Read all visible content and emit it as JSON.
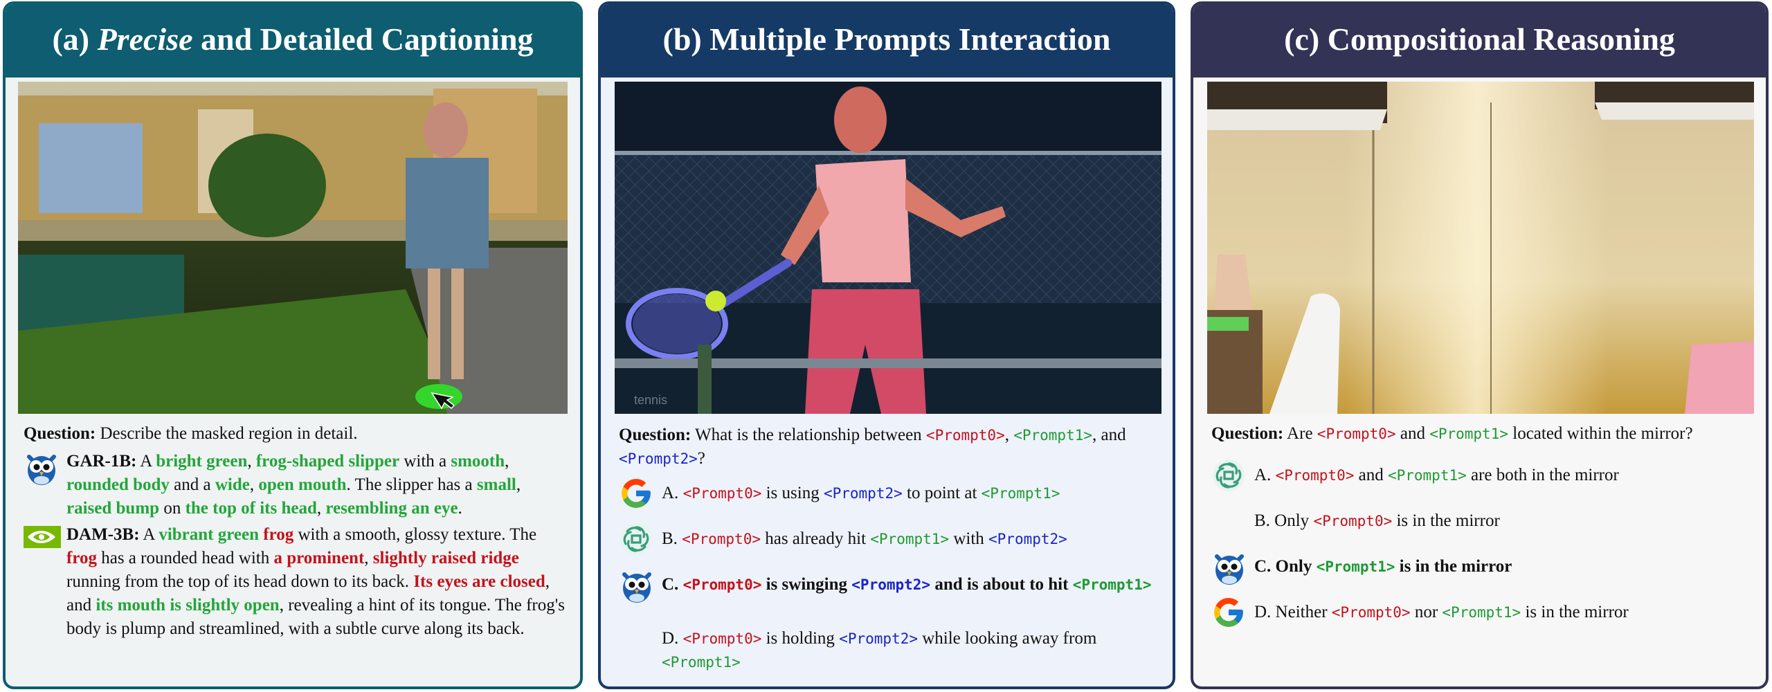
{
  "panels": {
    "a": {
      "title_prefix": "(a) ",
      "title_italic": "Precise",
      "title_suffix": " and Detailed Captioning",
      "question_label": "Question:",
      "question_text": " Describe the masked region in detail.",
      "gar": {
        "label": "GAR-1B:",
        "segments": [
          {
            "t": " A ",
            "c": ""
          },
          {
            "t": "bright green",
            "c": "green"
          },
          {
            "t": ", ",
            "c": ""
          },
          {
            "t": "frog-shaped slipper",
            "c": "green"
          },
          {
            "t": " with a ",
            "c": ""
          },
          {
            "t": "smooth",
            "c": "green"
          },
          {
            "t": ", ",
            "c": ""
          },
          {
            "t": "rounded body",
            "c": "green"
          },
          {
            "t": " and a ",
            "c": ""
          },
          {
            "t": "wide",
            "c": "green"
          },
          {
            "t": ", ",
            "c": ""
          },
          {
            "t": "open mouth",
            "c": "green"
          },
          {
            "t": ". The slipper has a ",
            "c": ""
          },
          {
            "t": "small",
            "c": "green"
          },
          {
            "t": ", ",
            "c": ""
          },
          {
            "t": "raised bump",
            "c": "green"
          },
          {
            "t": " on ",
            "c": ""
          },
          {
            "t": "the top of its head",
            "c": "green"
          },
          {
            "t": ", ",
            "c": ""
          },
          {
            "t": "resembling an eye",
            "c": "green"
          },
          {
            "t": ".",
            "c": ""
          }
        ]
      },
      "dam": {
        "label": "DAM-3B:",
        "segments": [
          {
            "t": " A ",
            "c": ""
          },
          {
            "t": "vibrant green",
            "c": "green"
          },
          {
            "t": " ",
            "c": ""
          },
          {
            "t": "frog",
            "c": "red"
          },
          {
            "t": " with a smooth, glossy texture. The ",
            "c": ""
          },
          {
            "t": "frog",
            "c": "red"
          },
          {
            "t": " has a rounded head with ",
            "c": ""
          },
          {
            "t": "a prominent",
            "c": "red"
          },
          {
            "t": ", ",
            "c": ""
          },
          {
            "t": "slightly raised ridge",
            "c": "red"
          },
          {
            "t": " running from the top of its head down to its back. ",
            "c": ""
          },
          {
            "t": "Its eyes are closed",
            "c": "red"
          },
          {
            "t": ", and ",
            "c": ""
          },
          {
            "t": "its mouth is slightly open",
            "c": "green"
          },
          {
            "t": ", revealing a hint of its tongue. The frog's body is plump and streamlined, with a subtle curve along its back.",
            "c": ""
          }
        ]
      }
    },
    "b": {
      "title": "(b) Multiple Prompts Interaction",
      "watermark": "tennis",
      "question_label": "Question:",
      "question_segments": [
        {
          "t": " What is the relationship between ",
          "c": ""
        },
        {
          "t": "<Prompt0>",
          "c": "p0"
        },
        {
          "t": ", ",
          "c": ""
        },
        {
          "t": "<Prompt1>",
          "c": "p1"
        },
        {
          "t": ", and ",
          "c": ""
        },
        {
          "t": "<Prompt2>",
          "c": "p2"
        },
        {
          "t": "?",
          "c": ""
        }
      ],
      "options": [
        {
          "logo": "google",
          "bold": false,
          "segments": [
            {
              "t": "A. ",
              "c": ""
            },
            {
              "t": "<Prompt0>",
              "c": "p0"
            },
            {
              "t": " is using ",
              "c": ""
            },
            {
              "t": "<Prompt2>",
              "c": "p2"
            },
            {
              "t": " to point at ",
              "c": ""
            },
            {
              "t": "<Prompt1>",
              "c": "p1"
            }
          ]
        },
        {
          "logo": "openai",
          "bold": false,
          "segments": [
            {
              "t": "B. ",
              "c": ""
            },
            {
              "t": "<Prompt0>",
              "c": "p0"
            },
            {
              "t": " has already hit ",
              "c": ""
            },
            {
              "t": "<Prompt1>",
              "c": "p1"
            },
            {
              "t": " with ",
              "c": ""
            },
            {
              "t": "<Prompt2>",
              "c": "p2"
            }
          ]
        },
        {
          "logo": "owl",
          "bold": true,
          "segments": [
            {
              "t": "C. ",
              "c": ""
            },
            {
              "t": "<Prompt0>",
              "c": "p0"
            },
            {
              "t": " is swinging ",
              "c": ""
            },
            {
              "t": "<Prompt2>",
              "c": "p2"
            },
            {
              "t": " and is about to hit ",
              "c": ""
            },
            {
              "t": "<Prompt1>",
              "c": "p1"
            }
          ]
        },
        {
          "logo": "",
          "bold": false,
          "segments": [
            {
              "t": "D. ",
              "c": ""
            },
            {
              "t": "<Prompt0>",
              "c": "p0"
            },
            {
              "t": " is holding ",
              "c": ""
            },
            {
              "t": "<Prompt2>",
              "c": "p2"
            },
            {
              "t": " while looking away from ",
              "c": ""
            },
            {
              "t": "<Prompt1>",
              "c": "p1"
            }
          ]
        }
      ]
    },
    "c": {
      "title": "(c) Compositional Reasoning",
      "question_label": "Question:",
      "question_segments": [
        {
          "t": " Are ",
          "c": ""
        },
        {
          "t": "<Prompt0>",
          "c": "p0"
        },
        {
          "t": " and ",
          "c": ""
        },
        {
          "t": "<Prompt1>",
          "c": "p1"
        },
        {
          "t": " located within the mirror?",
          "c": ""
        }
      ],
      "options": [
        {
          "logo": "openai",
          "bold": false,
          "segments": [
            {
              "t": "A. ",
              "c": ""
            },
            {
              "t": "<Prompt0>",
              "c": "p0"
            },
            {
              "t": " and ",
              "c": ""
            },
            {
              "t": "<Prompt1>",
              "c": "p1"
            },
            {
              "t": " are both in the mirror",
              "c": ""
            }
          ]
        },
        {
          "logo": "",
          "bold": false,
          "segments": [
            {
              "t": "B. Only ",
              "c": ""
            },
            {
              "t": "<Prompt0>",
              "c": "p0"
            },
            {
              "t": " is in the mirror",
              "c": ""
            }
          ]
        },
        {
          "logo": "owl",
          "bold": true,
          "segments": [
            {
              "t": "C. Only ",
              "c": ""
            },
            {
              "t": "<Prompt1>",
              "c": "p1"
            },
            {
              "t": " is in the mirror",
              "c": ""
            }
          ]
        },
        {
          "logo": "google",
          "bold": false,
          "segments": [
            {
              "t": "D. Neither ",
              "c": ""
            },
            {
              "t": "<Prompt0>",
              "c": "p0"
            },
            {
              "t": " nor ",
              "c": ""
            },
            {
              "t": "<Prompt1>",
              "c": "p1"
            },
            {
              "t": " is in the mirror",
              "c": ""
            }
          ]
        }
      ]
    }
  },
  "colors": {
    "panel_a_header": "#0e5d70",
    "panel_b_header": "#163a66",
    "panel_c_header": "#333356",
    "highlight_green": "#22a63a",
    "highlight_red": "#c4121c",
    "prompt0": "#c4121c",
    "prompt1": "#1e9a33",
    "prompt2": "#1a24c7"
  }
}
